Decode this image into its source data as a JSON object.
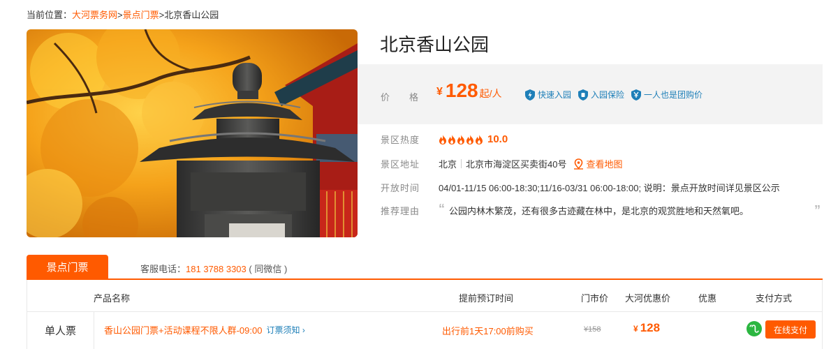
{
  "breadcrumb": {
    "prefix": "当前位置：",
    "items": [
      "大河票务网",
      "景点门票",
      "北京香山公园"
    ],
    "sep": ">"
  },
  "attraction": {
    "title": "北京香山公园",
    "price_label": "价格",
    "price_symbol": "¥",
    "price_value": "128",
    "price_unit": "起/人",
    "badges": [
      "快速入园",
      "入园保险",
      "一人也是团购价"
    ],
    "heat_label": "景区热度",
    "heat_score": "10.0",
    "heat_flames": 5,
    "address_label": "景区地址",
    "city": "北京",
    "address": "北京市海淀区买卖街40号",
    "map_link": "查看地图",
    "hours_label": "开放时间",
    "hours": "04/01-11/15 06:00-18:30;11/16-03/31 06:00-18:00; 说明：景点开放时间详见景区公示",
    "reason_label": "推荐理由",
    "reason": "公园内林木繁茂，还有很多古迹藏在林中，是北京的观赏胜地和天然氧吧。"
  },
  "tickets": {
    "tab_label": "景点门票",
    "service_label": "客服电话：",
    "service_phone": "181 3788 3303",
    "service_note": "( 同微信 )",
    "headers": [
      "产品名称",
      "提前预订时间",
      "门市价",
      "大河优惠价",
      "优惠",
      "支付方式"
    ],
    "rows": [
      {
        "type": "单人票",
        "product": "香山公园门票+活动课程不限人群-09:00",
        "notice": "订票须知",
        "book_time": "出行前1天17:00前购买",
        "list_price": "¥158",
        "deal_symbol": "¥",
        "deal_price": "128",
        "pay_label": "在线支付"
      }
    ]
  },
  "colors": {
    "accent": "#ff5a00",
    "link_blue": "#1e7fb8",
    "wechat_green": "#2bb640"
  }
}
